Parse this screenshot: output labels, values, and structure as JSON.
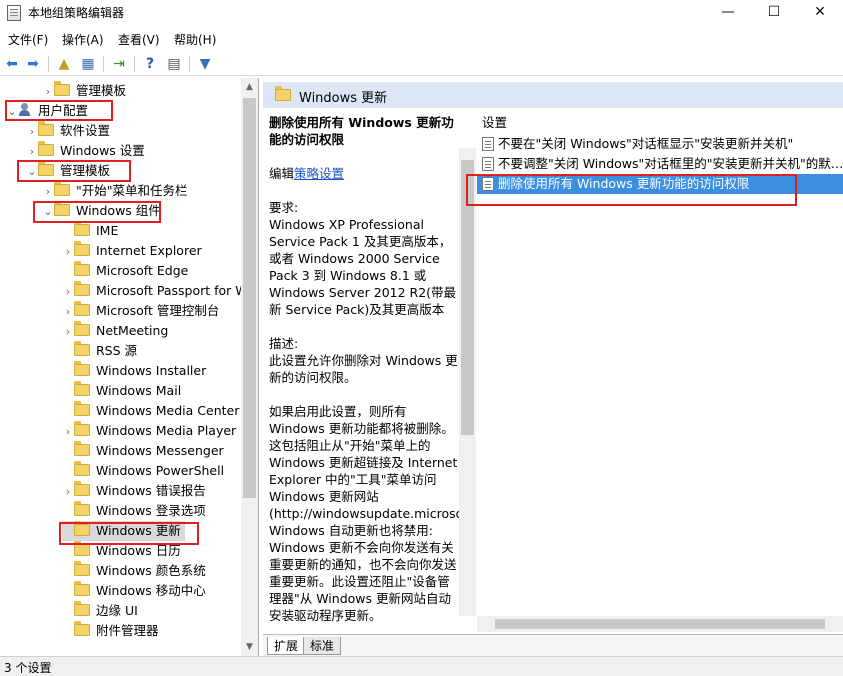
{
  "window": {
    "title": "本地组策略编辑器",
    "controls": {
      "minimize": "—",
      "maximize": "☐",
      "close": "✕"
    }
  },
  "menu": [
    "文件(F)",
    "操作(A)",
    "查看(V)",
    "帮助(H)"
  ],
  "toolbar": {
    "icons": [
      "back-arrow-icon",
      "forward-arrow-icon",
      "folder-up-icon",
      "show-hide-tree-icon",
      "export-list-icon",
      "help-icon",
      "properties-icon",
      "filter-icon"
    ]
  },
  "tree": [
    {
      "label": "管理模板",
      "level": 2,
      "chevron": "›"
    },
    {
      "label": "用户配置",
      "level": 0,
      "chevron": "⌄",
      "icon": "user"
    },
    {
      "label": "软件设置",
      "level": 1,
      "chevron": "›"
    },
    {
      "label": "Windows 设置",
      "level": 1,
      "chevron": "›"
    },
    {
      "label": "管理模板",
      "level": 1,
      "chevron": "⌄"
    },
    {
      "label": "\"开始\"菜单和任务栏",
      "level": 2,
      "chevron": "›"
    },
    {
      "label": "Windows 组件",
      "level": 2,
      "chevron": "⌄"
    },
    {
      "label": "IME",
      "level": 3,
      "chevron": ""
    },
    {
      "label": "Internet Explorer",
      "level": 3,
      "chevron": "›"
    },
    {
      "label": "Microsoft Edge",
      "level": 3,
      "chevron": ""
    },
    {
      "label": "Microsoft Passport for W",
      "level": 3,
      "chevron": "›"
    },
    {
      "label": "Microsoft 管理控制台",
      "level": 3,
      "chevron": "›"
    },
    {
      "label": "NetMeeting",
      "level": 3,
      "chevron": "›"
    },
    {
      "label": "RSS 源",
      "level": 3,
      "chevron": ""
    },
    {
      "label": "Windows Installer",
      "level": 3,
      "chevron": ""
    },
    {
      "label": "Windows Mail",
      "level": 3,
      "chevron": ""
    },
    {
      "label": "Windows Media Center",
      "level": 3,
      "chevron": ""
    },
    {
      "label": "Windows Media Player",
      "level": 3,
      "chevron": "›"
    },
    {
      "label": "Windows Messenger",
      "level": 3,
      "chevron": ""
    },
    {
      "label": "Windows PowerShell",
      "level": 3,
      "chevron": ""
    },
    {
      "label": "Windows 错误报告",
      "level": 3,
      "chevron": "›"
    },
    {
      "label": "Windows 登录选项",
      "level": 3,
      "chevron": ""
    },
    {
      "label": "Windows 更新",
      "level": 3,
      "chevron": "",
      "selected": true
    },
    {
      "label": "Windows 日历",
      "level": 3,
      "chevron": ""
    },
    {
      "label": "Windows 颜色系统",
      "level": 3,
      "chevron": ""
    },
    {
      "label": "Windows 移动中心",
      "level": 3,
      "chevron": ""
    },
    {
      "label": "边缘 UI",
      "level": 3,
      "chevron": ""
    },
    {
      "label": "附件管理器",
      "level": 3,
      "chevron": ""
    }
  ],
  "right": {
    "header": "Windows 更新",
    "list_header": "设置",
    "items": [
      {
        "label": "不要在\"关闭 Windows\"对话框显示\"安装更新并关机\"",
        "selected": false
      },
      {
        "label": "不要调整\"关闭 Windows\"对话框里的\"安装更新并关机\"的默…",
        "selected": false
      },
      {
        "label": "删除使用所有 Windows 更新功能的访问权限",
        "selected": true
      }
    ]
  },
  "description": {
    "title": "删除使用所有 Windows 更新功能的访问权限",
    "edit_prefix": "编辑",
    "edit_link": "策略设置",
    "requirements_label": "要求:",
    "requirements": "Windows XP Professional Service Pack 1 及其更高版本，或者 Windows 2000 Service Pack 3 到 Windows 8.1 或 Windows Server 2012 R2(带最新 Service Pack)及其更高版本",
    "desc_label": "描述:",
    "desc": "此设置允许你删除对 Windows 更新的访问权限。",
    "detail": "如果启用此设置，则所有 Windows 更新功能都将被删除。这包括阻止从\"开始\"菜单上的 Windows 更新超链接及 Internet Explorer 中的\"工具\"菜单访问 Windows 更新网站(http://windowsupdate.microsoft.com)。Windows 自动更新也将禁用: Windows 更新不会向你发送有关重要更新的通知，也不会向你发送重要更新。此设置还阻止\"设备管理器\"从 Windows 更新网站自动安装驱动程序更新。"
  },
  "tabs": [
    "扩展",
    "标准"
  ],
  "status": "3 个设置",
  "colors": {
    "selection": "#3b8ee0",
    "highlight_box": "#e0201e",
    "header_bg": "#dce6f4"
  }
}
